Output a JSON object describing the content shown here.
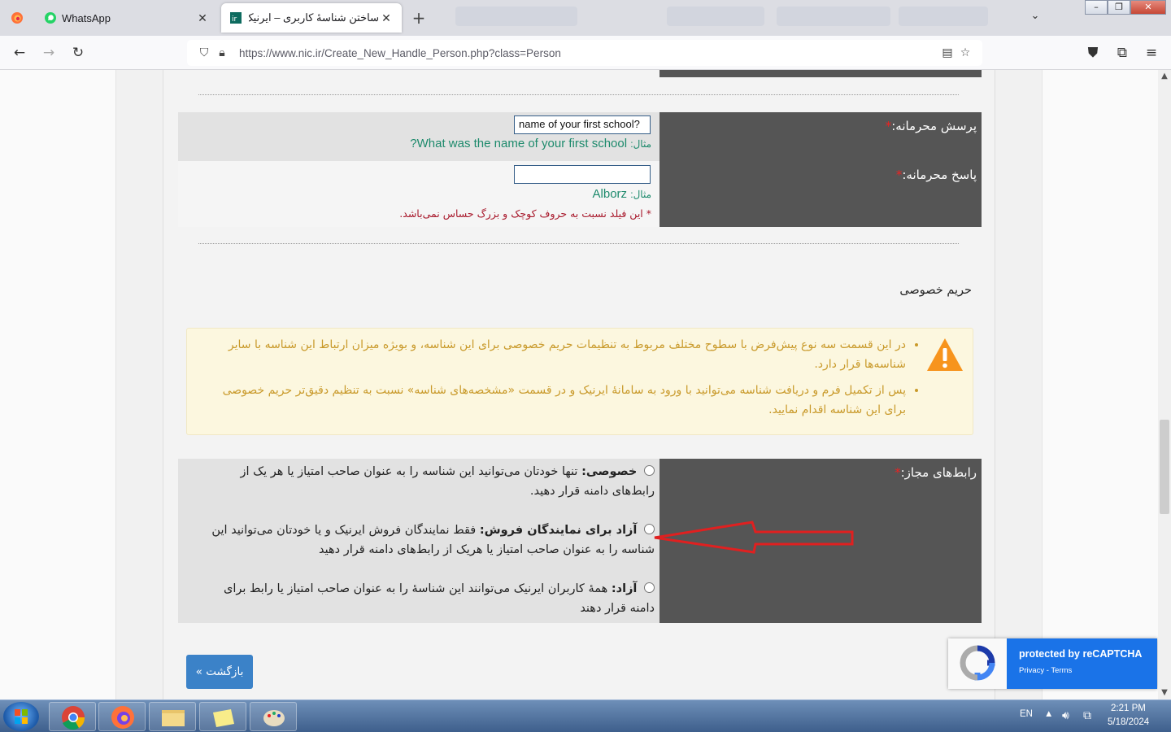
{
  "browser": {
    "tabs": [
      {
        "title": "",
        "icon": "firefox-icon"
      },
      {
        "title": "WhatsApp",
        "icon": "whatsapp-icon"
      },
      {
        "title": "ساختن شناسهٔ کاربری – ایرنیک",
        "icon": "irnic-icon",
        "active": true
      }
    ],
    "new_tab": "+",
    "url": "https://www.nic.ir/Create_New_Handle_Person.php?class=Person"
  },
  "form": {
    "secret_question": {
      "label": "پرسش محرمانه:",
      "required": "*",
      "value": "name of your first school?",
      "example_prefix": "مثال:",
      "example": "What was the name of your first school?"
    },
    "secret_answer": {
      "label": "پاسخ محرمانه:",
      "required": "*",
      "value": "",
      "example_prefix": "مثال:",
      "example": "Alborz",
      "note": "* این فیلد نسبت به حروف کوچک و بزرگ حساس نمی‌باشد."
    }
  },
  "privacy": {
    "title": "حریم خصوصی",
    "bullets": [
      "در این قسمت سه نوع پیش‌فرض با سطوح مختلف مربوط به تنظیمات حریم خصوصی برای این شناسه، و بویژه میزان ارتباط این شناسه با سایر شناسه‌ها قرار دارد.",
      "پس از تکمیل فرم و دریافت شناسه می‌توانید با ورود به سامانهٔ ایرنیک و در قسمت «مشخصه‌های شناسه» نسبت به تنظیم دقیق‌تر حریم خصوصی برای این شناسه اقدام نمایید."
    ],
    "warning_color": "#f7941d"
  },
  "relations": {
    "label": "رابط‌های مجاز:",
    "required": "*",
    "options": [
      {
        "title": "خصوصی:",
        "text": "تنها خودتان می‌توانید این شناسه را به عنوان صاحب امتیاز یا هر یک از رابط‌های دامنه قرار دهید."
      },
      {
        "title": "آزاد برای نمایندگان فروش:",
        "text": "فقط نمایندگان فروش ایرنیک و یا خودتان می‌توانید این شناسه را به عنوان صاحب امتیاز یا هریک از رابط‌های دامنه قرار دهید"
      },
      {
        "title": "آزاد:",
        "text": "همهٔ کاربران ایرنیک می‌توانند این شناسهٔ را به عنوان صاحب امتیاز یا رابط برای دامنه قرار دهند"
      }
    ]
  },
  "back_button": "بازگشت »",
  "recaptcha": {
    "title": "protected by reCAPTCHA",
    "links": "Privacy - Terms"
  },
  "taskbar": {
    "lang": "EN",
    "time": "2:21 PM",
    "date": "5/18/2024"
  },
  "colors": {
    "label_bg": "#555555",
    "example": "#1d8a6c",
    "note": "#a8182b",
    "warning_text": "#c99a2b",
    "button": "#3b82c8",
    "annotation_arrow": "#e02020"
  }
}
